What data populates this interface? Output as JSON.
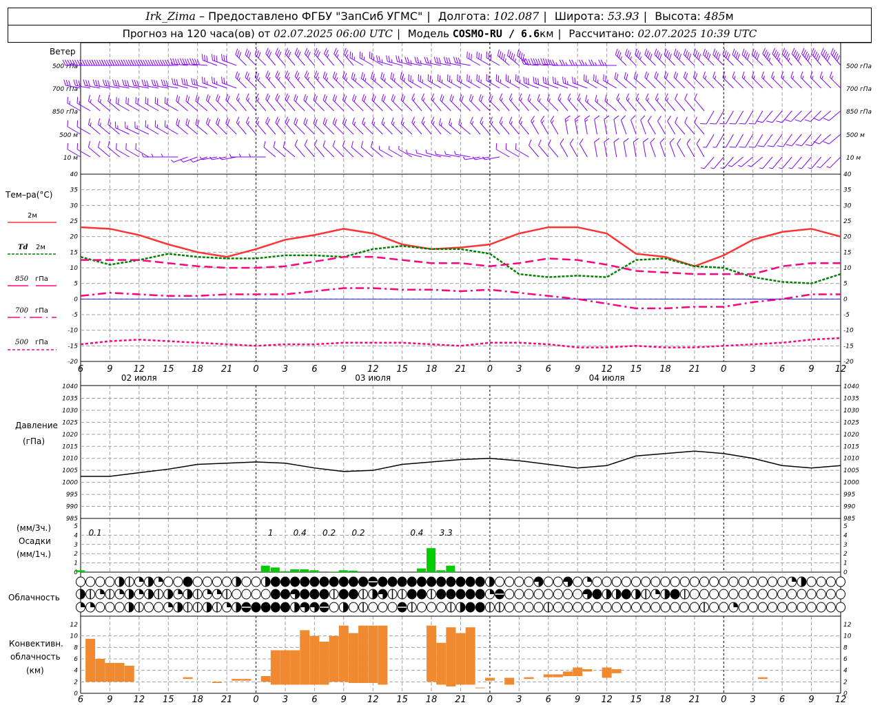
{
  "header": {
    "station": "Irk_Zima",
    "provider": "– Предоставлено ФГБУ \"ЗапСиб УГМС\"",
    "lon_label": "Долгота:",
    "lon": "102.087",
    "lat_label": "Широта:",
    "lat": "53.93",
    "alt_label": "Высота:",
    "alt": "485",
    "alt_unit": "м",
    "forecast_label": "Прогноз на 120 часа(ов) от",
    "forecast_start": "02.07.2025 06:00 UTC",
    "model_label": "Модель",
    "model": "COSMO-RU / 6.6",
    "model_unit": "км",
    "calc_label": "Рассчитано:",
    "calc_time": "02.07.2025 10:39 UTC"
  },
  "colors": {
    "wind": "#8000ff",
    "t2m": "#ff3333",
    "td": "#008000",
    "isobaric": "#ff0080",
    "zero": "#0000ff",
    "precip": "#00cc00",
    "conv": "#f08a30",
    "grid": "#a0a0a0"
  },
  "labels": {
    "wind": "Ветер",
    "wind_levels": [
      "500 гПа",
      "700 гПа",
      "850 гПа",
      "500  м",
      "10   м"
    ],
    "temp": "Тем–ра(°C)",
    "t2m": "2м",
    "td_sym": "Td",
    "td": "2м",
    "p850": "850",
    "p700": "700",
    "p500": "500",
    "gpa": "гПа",
    "pressure1": "Давление",
    "pressure2": "(гПа)",
    "precip1": "(мм/3ч.)",
    "precip2": "Осадки",
    "precip3": "(мм/1ч.)",
    "cloud": "Облачность",
    "conv1": "Конвективн.",
    "conv2": "облачность",
    "conv3": "(км)"
  },
  "time_axis": {
    "tick_labels": [
      "6",
      "9",
      "12",
      "15",
      "18",
      "21",
      "0",
      "3",
      "6",
      "9",
      "12",
      "15",
      "18",
      "21",
      "0",
      "3",
      "6",
      "9",
      "12",
      "15",
      "18",
      "21",
      "0",
      "3",
      "6",
      "9",
      "12"
    ],
    "dates": [
      "02 июля",
      "03 июля",
      "04 июля"
    ]
  },
  "chart_data": [
    {
      "type": "wind-barbs",
      "title": "Ветер",
      "levels": [
        "500 гПа",
        "700 гПа",
        "850 гПа",
        "500 м",
        "10 м"
      ],
      "times": "3-hourly from 02.07 06 UTC",
      "direction_deg": [
        [
          270,
          270,
          270,
          270,
          275,
          290,
          315,
          320,
          320,
          320,
          300,
          285,
          280,
          280,
          300,
          310,
          275,
          270,
          270,
          315,
          315,
          315,
          315,
          315,
          320,
          320,
          320
        ],
        [
          280,
          280,
          280,
          280,
          285,
          290,
          315,
          320,
          320,
          315,
          310,
          310,
          300,
          300,
          300,
          300,
          290,
          290,
          300,
          310,
          315,
          315,
          315,
          315,
          315,
          315,
          315
        ],
        [
          300,
          310,
          300,
          300,
          310,
          315,
          320,
          320,
          315,
          315,
          315,
          315,
          320,
          315,
          315,
          320,
          315,
          320,
          310,
          320,
          320,
          320,
          210,
          210,
          220,
          225,
          230
        ],
        [
          300,
          310,
          295,
          300,
          310,
          315,
          320,
          320,
          315,
          315,
          315,
          315,
          320,
          310,
          320,
          320,
          330,
          350,
          350,
          340,
          330,
          320,
          210,
          210,
          215,
          220,
          230
        ],
        [
          300,
          310,
          300,
          270,
          250,
          260,
          270,
          310,
          320,
          315,
          310,
          300,
          285,
          280,
          260,
          300,
          320,
          330,
          350,
          350,
          340,
          330,
          220,
          230,
          220,
          220,
          225
        ]
      ],
      "speed_ms": [
        [
          22,
          24,
          24,
          22,
          20,
          16,
          14,
          14,
          14,
          13,
          13,
          12,
          12,
          14,
          14,
          22,
          20,
          12,
          12,
          18,
          20,
          20,
          20,
          20,
          22,
          24,
          24
        ],
        [
          14,
          14,
          14,
          15,
          15,
          13,
          12,
          12,
          12,
          12,
          13,
          13,
          13,
          13,
          13,
          13,
          14,
          12,
          12,
          10,
          10,
          10,
          8,
          8,
          8,
          8,
          8
        ],
        [
          8,
          8,
          9,
          9,
          10,
          9,
          8,
          10,
          10,
          10,
          9,
          9,
          8,
          9,
          10,
          8,
          8,
          8,
          7,
          7,
          7,
          6,
          4,
          4,
          4,
          5,
          5
        ],
        [
          6,
          7,
          8,
          8,
          9,
          9,
          8,
          9,
          9,
          9,
          8,
          8,
          8,
          8,
          7,
          7,
          7,
          8,
          6,
          6,
          6,
          6,
          3,
          4,
          4,
          4,
          4
        ],
        [
          5,
          5,
          5,
          3,
          2,
          3,
          3,
          5,
          5,
          5,
          4,
          3,
          2,
          2,
          2,
          5,
          6,
          5,
          4,
          4,
          4,
          4,
          2,
          3,
          3,
          3,
          3
        ]
      ]
    },
    {
      "type": "line",
      "title": "Тем–ра(°C)",
      "ylim": [
        -20,
        40
      ],
      "yticks_step": 5,
      "grid": true,
      "x": "3-hourly, 02.07 06 UTC – 05.07 12 UTC",
      "series": [
        {
          "name": "2м",
          "values": [
            23,
            22.5,
            20.5,
            17.5,
            15,
            13.5,
            16,
            19,
            20.5,
            22.5,
            21,
            17.5,
            16,
            16.5,
            17.5,
            21,
            23,
            23,
            21,
            14.5,
            13.5,
            10.5,
            14,
            19,
            21.5,
            22.5,
            20
          ]
        },
        {
          "name": "Td 2м",
          "values": [
            13.5,
            11,
            12.5,
            14.5,
            13.5,
            13,
            13,
            14,
            14,
            13.5,
            16,
            17,
            16,
            16,
            14.5,
            8,
            7,
            7.5,
            7,
            12.5,
            13,
            10.5,
            10,
            7,
            5.5,
            5,
            8
          ]
        },
        {
          "name": "850 гПа",
          "values": [
            12.5,
            12.5,
            12.5,
            11.5,
            10.5,
            10,
            10,
            10.5,
            12,
            13.5,
            13.5,
            12.5,
            11.5,
            11.5,
            10.5,
            11.5,
            13,
            12.5,
            11,
            9,
            8.5,
            8,
            8,
            8,
            10.5,
            11.5,
            11.5
          ]
        },
        {
          "name": "700 гПа",
          "values": [
            1,
            2,
            1.5,
            1,
            1,
            1.5,
            1.5,
            1.5,
            2.5,
            3.5,
            3.5,
            3,
            3,
            2.5,
            3,
            2,
            1,
            0,
            -1.5,
            -3,
            -3,
            -2.5,
            -2.5,
            -1,
            0,
            1.5,
            1.5
          ]
        },
        {
          "name": "500 гПа",
          "values": [
            -14.5,
            -13.5,
            -13,
            -13.5,
            -14,
            -14.5,
            -15,
            -14.5,
            -14.5,
            -14,
            -14,
            -14,
            -14.5,
            -15,
            -14,
            -14,
            -14.5,
            -15.5,
            -15.5,
            -15,
            -15.5,
            -15.5,
            -15,
            -14.5,
            -14,
            -13,
            -12.5
          ]
        }
      ]
    },
    {
      "type": "line",
      "title": "Давление (гПа)",
      "ylim": [
        985,
        1040
      ],
      "yticks_step": 5,
      "grid": true,
      "values": [
        1002.5,
        1002.5,
        1004,
        1005.5,
        1007.5,
        1008,
        1008.5,
        1008,
        1006,
        1004.5,
        1005,
        1007.5,
        1008.5,
        1009.5,
        1010,
        1009,
        1007.5,
        1006,
        1007,
        1011,
        1012,
        1013,
        1012,
        1010,
        1007,
        1006,
        1007
      ]
    },
    {
      "type": "bar",
      "title": "Осадки",
      "ylabel": "мм/1ч.",
      "ylim": [
        0,
        5
      ],
      "hourly_values": [
        0.2,
        0,
        0,
        0,
        0,
        0,
        0,
        0,
        0,
        0,
        0,
        0,
        0,
        0,
        0,
        0,
        0,
        0,
        0,
        0.7,
        0.5,
        0.1,
        0.3,
        0.3,
        0.2,
        0,
        0.05,
        0.2,
        0.15,
        0,
        0,
        0,
        0,
        0,
        0,
        0.4,
        2.6,
        0.2,
        0.7,
        0,
        0,
        0,
        0,
        0,
        0,
        0,
        0,
        0,
        0,
        0,
        0,
        0,
        0,
        0,
        0,
        0,
        0,
        0,
        0,
        0,
        0,
        0,
        0,
        0,
        0,
        0,
        0,
        0,
        0,
        0,
        0,
        0,
        0,
        0,
        0,
        0,
        0,
        0
      ],
      "sum_3h_labels": [
        {
          "period": "06–09",
          "value": "0.1"
        },
        {
          "period": "00–03",
          "value": "1"
        },
        {
          "period": "03–06",
          "value": "0.4"
        },
        {
          "period": "06–09",
          "value": "0.2"
        },
        {
          "period": "09–12",
          "value": "0.2"
        },
        {
          "period": "15–18",
          "value": "0.4"
        },
        {
          "period": "18–21",
          "value": "3.3"
        }
      ],
      "sum_3h_hours": [
        1.5,
        19.5,
        22.5,
        25.5,
        28.5,
        34.5,
        37.5
      ]
    },
    {
      "type": "symbols",
      "title": "Облачность",
      "legend": "0 clear, 1 line, 2 quarter, 3 half, 4 three-quarter, 5 nearly full, 6 overcast",
      "rows": [
        "0000312320060000300366666666665666666666663000040040200000000000000000000230000001010",
        "3121232313231221000066466616613411661666662500000000463363123610000000000000000",
        "2200031002311312356666344503010005100013661100001000000000000000100200000000000"
      ]
    },
    {
      "type": "range-bar",
      "title": "Конвективн. облачность",
      "ylabel": "км",
      "ylim": [
        0,
        12
      ],
      "yticks_step": 2,
      "hourly_base_top": {
        "1": [
          2,
          9.5
        ],
        "2": [
          2,
          6
        ],
        "3": [
          2,
          5.3
        ],
        "4": [
          2,
          5.3
        ],
        "5": [
          2,
          4.8
        ],
        "11": [
          2.5,
          2.8
        ],
        "14": [
          1.8,
          2
        ],
        "16": [
          2.2,
          2.5
        ],
        "17": [
          2.2,
          2.5
        ],
        "19": [
          2,
          3
        ],
        "20": [
          1.5,
          7.5
        ],
        "21": [
          1.5,
          7.5
        ],
        "22": [
          1.5,
          7.5
        ],
        "23": [
          1.5,
          11
        ],
        "24": [
          1.5,
          10
        ],
        "25": [
          1.5,
          9
        ],
        "26": [
          2,
          10
        ],
        "27": [
          2,
          11.8
        ],
        "28": [
          1.8,
          10.5
        ],
        "29": [
          1.8,
          11.8
        ],
        "30": [
          1.8,
          11.8
        ],
        "31": [
          1.5,
          11.8
        ],
        "36": [
          2,
          11.8
        ],
        "37": [
          1.5,
          8.8
        ],
        "38": [
          1.2,
          11.5
        ],
        "39": [
          1.5,
          10.5
        ],
        "40": [
          1.5,
          11.5
        ],
        "41": [
          0.9,
          1
        ],
        "42": [
          2.2,
          2.7
        ],
        "44": [
          1.5,
          2.7
        ],
        "46": [
          2.5,
          2.8
        ],
        "48": [
          2.8,
          3.3
        ],
        "49": [
          2.8,
          3.3
        ],
        "50": [
          3,
          3.8
        ],
        "51": [
          3,
          4.5
        ],
        "52": [
          3.8,
          4.2
        ],
        "54": [
          2.7,
          4.5
        ],
        "55": [
          3.5,
          4.2
        ],
        "70": [
          2.5,
          2.8
        ]
      }
    }
  ]
}
